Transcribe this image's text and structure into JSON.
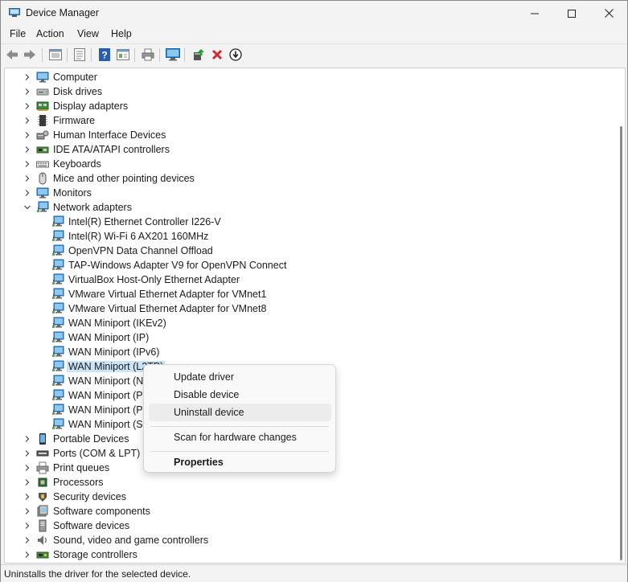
{
  "window": {
    "title": "Device Manager"
  },
  "menu": {
    "items": [
      "File",
      "Action",
      "View",
      "Help"
    ]
  },
  "toolbar": {
    "icons": [
      "back-icon",
      "forward-icon",
      "properties-view-icon",
      "details-icon",
      "help-icon",
      "action-view-icon",
      "print-icon",
      "monitor-icon",
      "update-driver-icon",
      "uninstall-icon",
      "download-icon"
    ]
  },
  "tree": {
    "categories_top": [
      {
        "label": "Computer",
        "icon": "computer-icon"
      },
      {
        "label": "Disk drives",
        "icon": "disk-icon"
      },
      {
        "label": "Display adapters",
        "icon": "display-icon"
      },
      {
        "label": "Firmware",
        "icon": "firmware-icon"
      },
      {
        "label": "Human Interface Devices",
        "icon": "hid-icon"
      },
      {
        "label": "IDE ATA/ATAPI controllers",
        "icon": "ide-icon"
      },
      {
        "label": "Keyboards",
        "icon": "keyboard-icon"
      },
      {
        "label": "Mice and other pointing devices",
        "icon": "mouse-icon"
      },
      {
        "label": "Monitors",
        "icon": "monitor-icon"
      }
    ],
    "network": {
      "label": "Network adapters",
      "children": [
        "Intel(R) Ethernet Controller I226-V",
        "Intel(R) Wi-Fi 6 AX201 160MHz",
        "OpenVPN Data Channel Offload",
        "TAP-Windows Adapter V9 for OpenVPN Connect",
        "VirtualBox Host-Only Ethernet Adapter",
        "VMware Virtual Ethernet Adapter for VMnet1",
        "VMware Virtual Ethernet Adapter for VMnet8",
        "WAN Miniport (IKEv2)",
        "WAN Miniport (IP)",
        "WAN Miniport (IPv6)",
        "WAN Miniport (L2TP)",
        "WAN Miniport (N",
        "WAN Miniport (Pl",
        "WAN Miniport (Pl",
        "WAN Miniport (SS"
      ]
    },
    "categories_bottom": [
      {
        "label": "Portable Devices",
        "icon": "portable-icon"
      },
      {
        "label": "Ports (COM & LPT)",
        "icon": "port-icon"
      },
      {
        "label": "Print queues",
        "icon": "printer-icon"
      },
      {
        "label": "Processors",
        "icon": "processor-icon"
      },
      {
        "label": "Security devices",
        "icon": "security-icon"
      },
      {
        "label": "Software components",
        "icon": "software-component-icon"
      },
      {
        "label": "Software devices",
        "icon": "software-device-icon"
      },
      {
        "label": "Sound, video and game controllers",
        "icon": "sound-icon"
      },
      {
        "label": "Storage controllers",
        "icon": "storage-icon"
      }
    ]
  },
  "context_menu": {
    "items": [
      "Update driver",
      "Disable device",
      "Uninstall device",
      "Scan for hardware changes",
      "Properties"
    ]
  },
  "status": {
    "text": "Uninstalls the driver for the selected device."
  },
  "colors": {
    "selection": "#cce4f7",
    "accent": "#0067c0",
    "close_red": "#d32a2a"
  }
}
